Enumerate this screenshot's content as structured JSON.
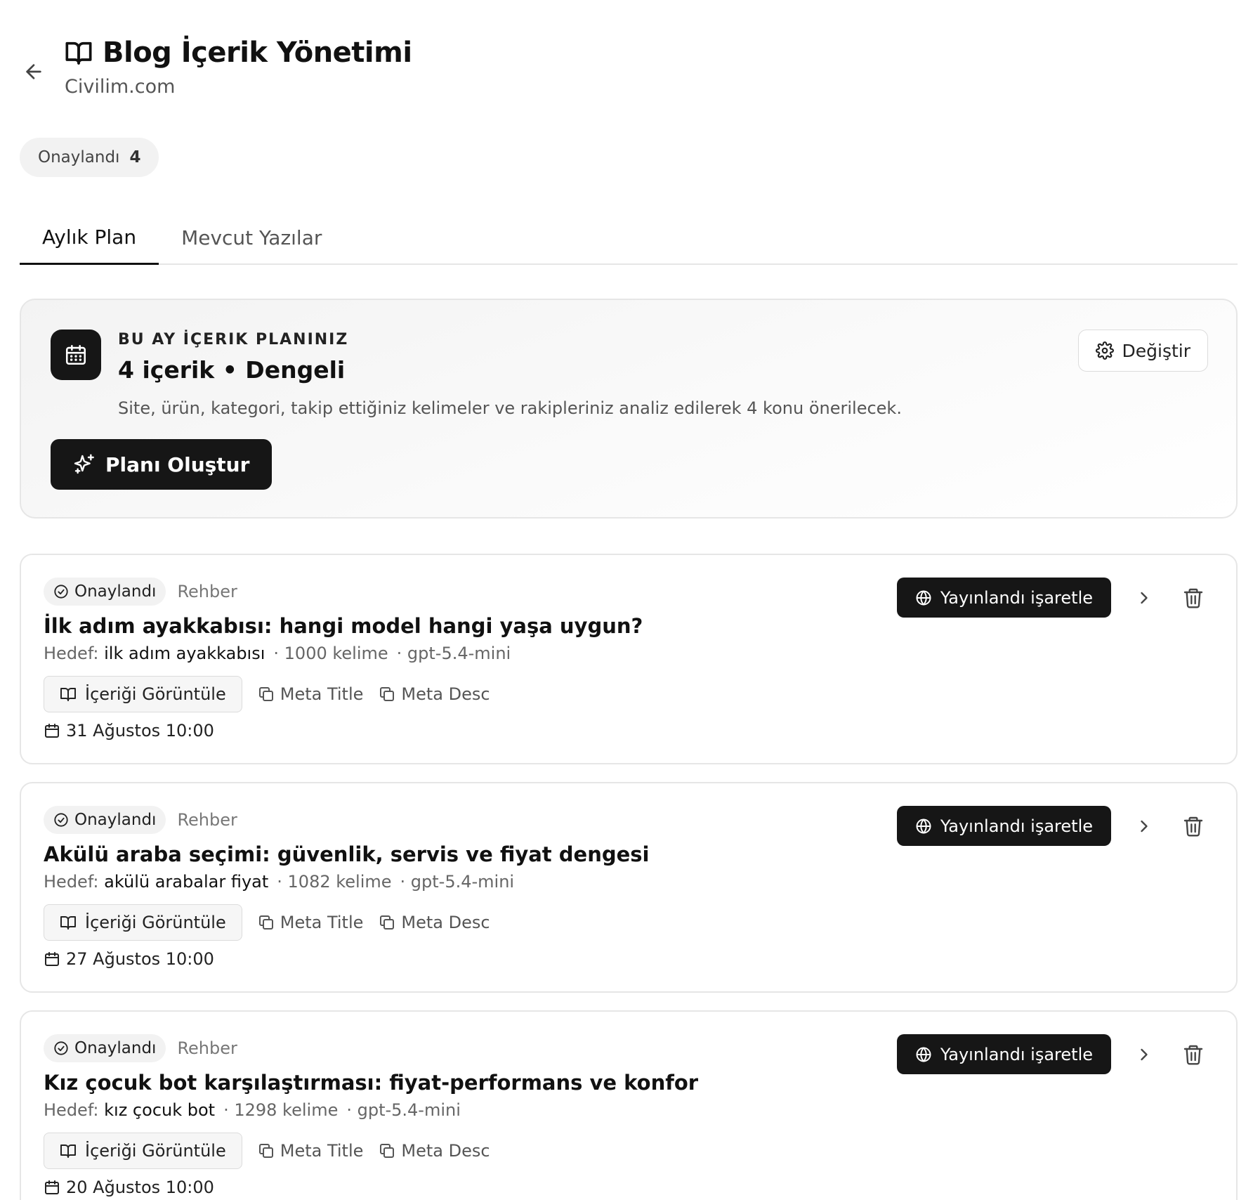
{
  "header": {
    "title": "Blog İçerik Yönetimi",
    "subtitle": "Civilim.com"
  },
  "status_summary": {
    "label": "Onaylandı",
    "count": "4"
  },
  "tabs": [
    {
      "label": "Aylık Plan",
      "active": true
    },
    {
      "label": "Mevcut Yazılar",
      "active": false
    }
  ],
  "plan": {
    "eyebrow": "BU AY İÇERIK PLANINIZ",
    "heading": "4 içerik • Dengeli",
    "description": "Site, ürün, kategori, takip ettiğiniz kelimeler ve rakipleriniz analiz edilerek 4 konu önerilecek.",
    "change_label": "Değiştir",
    "create_label": "Planı Oluştur"
  },
  "posts": [
    {
      "status": "Onaylandı",
      "type": "Rehber",
      "title": "İlk adım ayakkabısı: hangi model hangi yaşa uygun?",
      "target_label": "Hedef:",
      "target_keyword": "ilk adım ayakkabısı",
      "words": "· 1000 kelime",
      "model": "· gpt-5.4-mini",
      "view_label": "İçeriği Görüntüle",
      "meta_title_label": "Meta Title",
      "meta_desc_label": "Meta Desc",
      "date": "31 Ağustos 10:00",
      "publish_label": "Yayınlandı işaretle"
    },
    {
      "status": "Onaylandı",
      "type": "Rehber",
      "title": "Akülü araba seçimi: güvenlik, servis ve fiyat dengesi",
      "target_label": "Hedef:",
      "target_keyword": "akülü arabalar fiyat",
      "words": "· 1082 kelime",
      "model": "· gpt-5.4-mini",
      "view_label": "İçeriği Görüntüle",
      "meta_title_label": "Meta Title",
      "meta_desc_label": "Meta Desc",
      "date": "27 Ağustos 10:00",
      "publish_label": "Yayınlandı işaretle"
    },
    {
      "status": "Onaylandı",
      "type": "Rehber",
      "title": "Kız çocuk bot karşılaştırması: fiyat-performans ve konfor",
      "target_label": "Hedef:",
      "target_keyword": "kız çocuk bot",
      "words": "· 1298 kelime",
      "model": "· gpt-5.4-mini",
      "view_label": "İçeriği Görüntüle",
      "meta_title_label": "Meta Title",
      "meta_desc_label": "Meta Desc",
      "date": "20 Ağustos 10:00",
      "publish_label": "Yayınlandı işaretle"
    }
  ],
  "icons": {
    "back": "arrow-left-icon",
    "title": "open-book-icon",
    "plan": "calendar-icon",
    "change": "gear-icon",
    "create": "sparkles-icon",
    "status": "check-circle-icon",
    "publish": "globe-icon",
    "chevron": "chevron-right-icon",
    "delete": "trash-icon",
    "view": "open-book-icon",
    "copy": "copy-icon",
    "date": "calendar-icon"
  }
}
